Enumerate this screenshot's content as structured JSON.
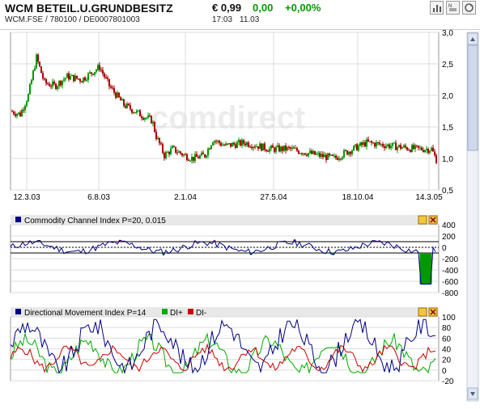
{
  "header": {
    "name": "WCM BETEIL.U.GRUNDBESITZ",
    "ids": "WCM.FSE  /  780100  /  DE0007801003",
    "price": "€ 0,99",
    "change": "0,00",
    "change_pct": "+0,00%",
    "time": "17:03",
    "date": "11.03",
    "watermark": "comdirect",
    "icons": [
      "chart-bars-icon",
      "news-icon",
      "refresh-icon"
    ]
  },
  "colors": {
    "up": "#009900",
    "down": "#aa0000",
    "indicator_line": "#000080",
    "di_plus": "#00aa00",
    "di_minus": "#cc0000",
    "panel_header_bg": "#e8e8e8",
    "grid": "#dcdcdc"
  },
  "chart_data": [
    {
      "type": "line",
      "title": "",
      "x_tick_labels": [
        "12.3.03",
        "6.8.03",
        "2.1.04",
        "27.5.04",
        "18.10.04",
        "14.3.05"
      ],
      "y_tick_labels": [
        "3,0",
        "2,5",
        "2,0",
        "1,5",
        "1,0",
        "0,5"
      ],
      "ylim": [
        0.5,
        3.0
      ],
      "grid": true,
      "series": [
        {
          "x": [
            "12.3.03",
            "6.8.03",
            "2.1.04",
            "27.5.04",
            "18.10.04",
            "14.3.05"
          ],
          "values": [
            1.7,
            2.25,
            1.1,
            1.2,
            1.1,
            0.97
          ]
        }
      ]
    },
    {
      "type": "line",
      "title": "Commodity Channel Index P=20, 0.015",
      "y_tick_labels": [
        "400",
        "200",
        "0",
        "-200",
        "-400",
        "-600",
        "-800"
      ],
      "ylim": [
        -800,
        400
      ],
      "reference_lines": [
        100,
        -100
      ],
      "grid": true
    },
    {
      "type": "line",
      "title": "Directional Movement Index P=14",
      "legend": [
        "DI+",
        "DI-"
      ],
      "y_tick_labels": [
        "100",
        "80",
        "60",
        "40",
        "20",
        "0",
        "-20"
      ],
      "ylim": [
        -20,
        100
      ],
      "grid": true
    }
  ]
}
